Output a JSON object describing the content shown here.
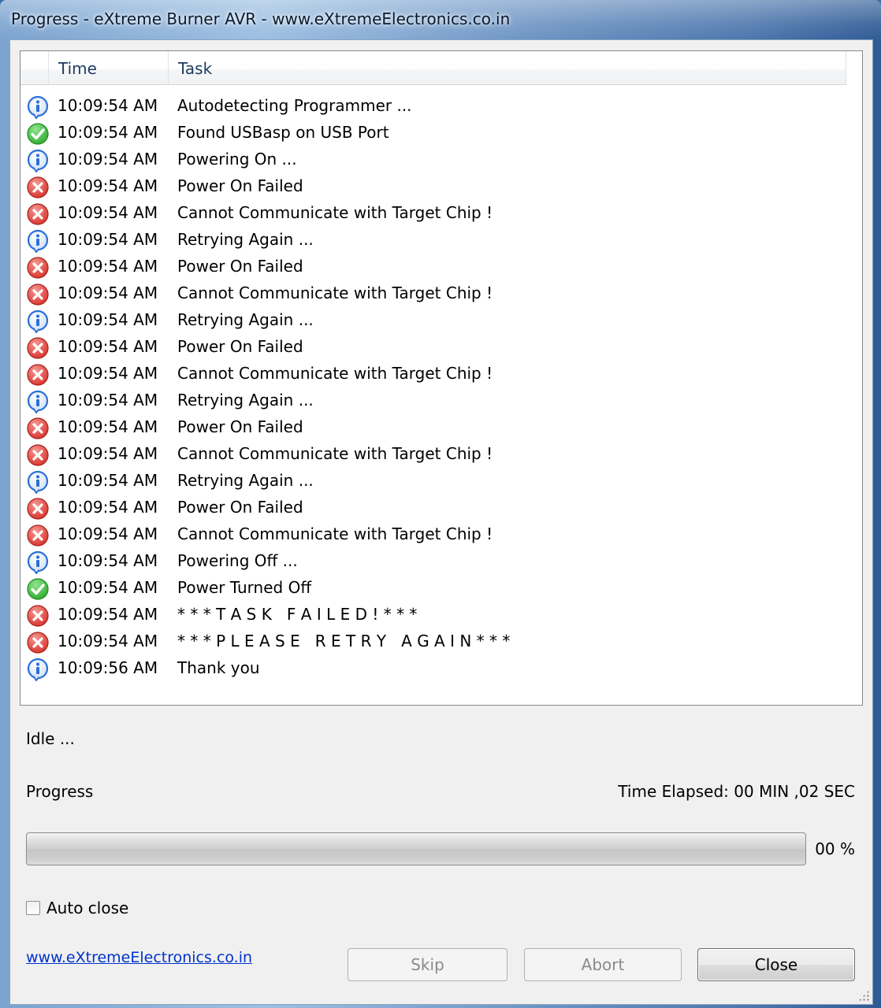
{
  "window": {
    "title": "Progress - eXtreme Burner AVR - www.eXtremeElectronics.co.in"
  },
  "log": {
    "columns": {
      "icon": "",
      "time": "Time",
      "task": "Task"
    },
    "rows": [
      {
        "status": "info",
        "time": "10:09:54 AM",
        "task": "Autodetecting Programmer ..."
      },
      {
        "status": "success",
        "time": "10:09:54 AM",
        "task": "Found USBasp on USB Port"
      },
      {
        "status": "info",
        "time": "10:09:54 AM",
        "task": "Powering On ..."
      },
      {
        "status": "error",
        "time": "10:09:54 AM",
        "task": "Power On Failed"
      },
      {
        "status": "error",
        "time": "10:09:54 AM",
        "task": "Cannot Communicate with Target Chip !"
      },
      {
        "status": "info",
        "time": "10:09:54 AM",
        "task": "Retrying Again ..."
      },
      {
        "status": "error",
        "time": "10:09:54 AM",
        "task": "Power On Failed"
      },
      {
        "status": "error",
        "time": "10:09:54 AM",
        "task": "Cannot Communicate with Target Chip !"
      },
      {
        "status": "info",
        "time": "10:09:54 AM",
        "task": "Retrying Again ..."
      },
      {
        "status": "error",
        "time": "10:09:54 AM",
        "task": "Power On Failed"
      },
      {
        "status": "error",
        "time": "10:09:54 AM",
        "task": "Cannot Communicate with Target Chip !"
      },
      {
        "status": "info",
        "time": "10:09:54 AM",
        "task": "Retrying Again ..."
      },
      {
        "status": "error",
        "time": "10:09:54 AM",
        "task": "Power On Failed"
      },
      {
        "status": "error",
        "time": "10:09:54 AM",
        "task": "Cannot Communicate with Target Chip !"
      },
      {
        "status": "info",
        "time": "10:09:54 AM",
        "task": "Retrying Again ..."
      },
      {
        "status": "error",
        "time": "10:09:54 AM",
        "task": "Power On Failed"
      },
      {
        "status": "error",
        "time": "10:09:54 AM",
        "task": "Cannot Communicate with Target Chip !"
      },
      {
        "status": "info",
        "time": "10:09:54 AM",
        "task": "Powering Off ..."
      },
      {
        "status": "success",
        "time": "10:09:54 AM",
        "task": "Power Turned Off"
      },
      {
        "status": "error",
        "time": "10:09:54 AM",
        "task": "* * * T A S K   F A I L E D ! * * *"
      },
      {
        "status": "error",
        "time": "10:09:54 AM",
        "task": "* * * P L E A S E   R E T R Y   A G A I N * * *"
      },
      {
        "status": "info",
        "time": "10:09:56 AM",
        "task": "Thank you"
      }
    ]
  },
  "status": {
    "text": "Idle ..."
  },
  "progress": {
    "label": "Progress",
    "elapsed": "Time Elapsed: 00 MIN ,02 SEC",
    "percent_text": "00 %",
    "value": 0
  },
  "options": {
    "auto_close_label": "Auto close",
    "auto_close_checked": false
  },
  "footer": {
    "link_text": "www.eXtremeElectronics.co.in",
    "skip_label": "Skip",
    "abort_label": "Abort",
    "close_label": "Close"
  },
  "icons": {
    "info": "info-icon",
    "success": "check-circle-icon",
    "error": "error-x-icon"
  },
  "colors": {
    "info": "#2a6fd6",
    "success": "#2eaa2e",
    "error": "#d9302a",
    "link": "#0033cc"
  }
}
